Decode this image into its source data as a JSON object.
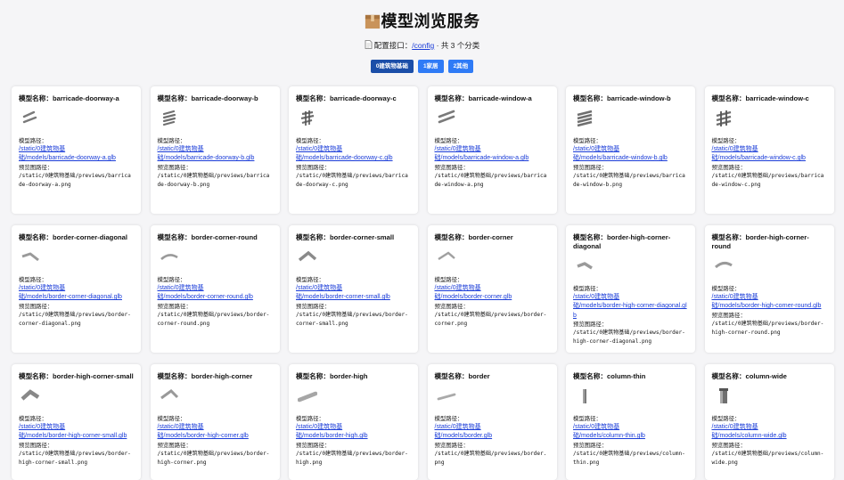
{
  "header": {
    "title": "模型浏览服务",
    "config_prefix": "配置接口：",
    "config_link": "/config",
    "config_suffix": " · 共 3 个分类"
  },
  "tabs": [
    {
      "label": "0建筑物基础",
      "active": true
    },
    {
      "label": "1家居",
      "active": false
    },
    {
      "label": "2其他",
      "active": false
    }
  ],
  "labels": {
    "name_prefix": "模型名称：",
    "model_path": "模型路径：",
    "preview_path": "预览图路径："
  },
  "models": [
    {
      "name": "barricade-doorway-a",
      "link_a": "/static/0建筑物基",
      "link_b": "础/models/barricade-doorway-a.glb",
      "preview": "/static/0建筑物基础/previews/barricade-doorway-a.png",
      "icon": "barricade-doorway-a-icon"
    },
    {
      "name": "barricade-doorway-b",
      "link_a": "/static/0建筑物基",
      "link_b": "础/models/barricade-doorway-b.glb",
      "preview": "/static/0建筑物基础/previews/barricade-doorway-b.png",
      "icon": "barricade-doorway-b-icon"
    },
    {
      "name": "barricade-doorway-c",
      "link_a": "/static/0建筑物基",
      "link_b": "础/models/barricade-doorway-c.glb",
      "preview": "/static/0建筑物基础/previews/barricade-doorway-c.png",
      "icon": "barricade-doorway-c-icon"
    },
    {
      "name": "barricade-window-a",
      "link_a": "/static/0建筑物基",
      "link_b": "础/models/barricade-window-a.glb",
      "preview": "/static/0建筑物基础/previews/barricade-window-a.png",
      "icon": "barricade-window-a-icon"
    },
    {
      "name": "barricade-window-b",
      "link_a": "/static/0建筑物基",
      "link_b": "础/models/barricade-window-b.glb",
      "preview": "/static/0建筑物基础/previews/barricade-window-b.png",
      "icon": "barricade-window-b-icon"
    },
    {
      "name": "barricade-window-c",
      "link_a": "/static/0建筑物基",
      "link_b": "础/models/barricade-window-c.glb",
      "preview": "/static/0建筑物基础/previews/barricade-window-c.png",
      "icon": "barricade-window-c-icon"
    },
    {
      "name": "border-corner-diagonal",
      "link_a": "/static/0建筑物基",
      "link_b": "础/models/border-corner-diagonal.glb",
      "preview": "/static/0建筑物基础/previews/border-corner-diagonal.png",
      "icon": "border-corner-diagonal-icon"
    },
    {
      "name": "border-corner-round",
      "link_a": "/static/0建筑物基",
      "link_b": "础/models/border-corner-round.glb",
      "preview": "/static/0建筑物基础/previews/border-corner-round.png",
      "icon": "border-corner-round-icon"
    },
    {
      "name": "border-corner-small",
      "link_a": "/static/0建筑物基",
      "link_b": "础/models/border-corner-small.glb",
      "preview": "/static/0建筑物基础/previews/border-corner-small.png",
      "icon": "border-corner-small-icon"
    },
    {
      "name": "border-corner",
      "link_a": "/static/0建筑物基",
      "link_b": "础/models/border-corner.glb",
      "preview": "/static/0建筑物基础/previews/border-corner.png",
      "icon": "border-corner-icon"
    },
    {
      "name": "border-high-corner-diagonal",
      "link_a": "/static/0建筑物基",
      "link_b": "础/models/border-high-corner-diagonal.glb",
      "preview": "/static/0建筑物基础/previews/border-high-corner-diagonal.png",
      "icon": "border-high-corner-diagonal-icon"
    },
    {
      "name": "border-high-corner-round",
      "link_a": "/static/0建筑物基",
      "link_b": "础/models/border-high-corner-round.glb",
      "preview": "/static/0建筑物基础/previews/border-high-corner-round.png",
      "icon": "border-high-corner-round-icon"
    },
    {
      "name": "border-high-corner-small",
      "link_a": "/static/0建筑物基",
      "link_b": "础/models/border-high-corner-small.glb",
      "preview": "/static/0建筑物基础/previews/border-high-corner-small.png",
      "icon": "border-high-corner-small-icon"
    },
    {
      "name": "border-high-corner",
      "link_a": "/static/0建筑物基",
      "link_b": "础/models/border-high-corner.glb",
      "preview": "/static/0建筑物基础/previews/border-high-corner.png",
      "icon": "border-high-corner-icon"
    },
    {
      "name": "border-high",
      "link_a": "/static/0建筑物基",
      "link_b": "础/models/border-high.glb",
      "preview": "/static/0建筑物基础/previews/border-high.png",
      "icon": "border-high-icon"
    },
    {
      "name": "border",
      "link_a": "/static/0建筑物基",
      "link_b": "础/models/border.glb",
      "preview": "/static/0建筑物基础/previews/border.png",
      "icon": "border-icon"
    },
    {
      "name": "column-thin",
      "link_a": "/static/0建筑物基",
      "link_b": "础/models/column-thin.glb",
      "preview": "/static/0建筑物基础/previews/column-thin.png",
      "icon": "column-thin-icon"
    },
    {
      "name": "column-wide",
      "link_a": "/static/0建筑物基",
      "link_b": "础/models/column-wide.glb",
      "preview": "/static/0建筑物基础/previews/column-wide.png",
      "icon": "column-wide-icon"
    }
  ]
}
